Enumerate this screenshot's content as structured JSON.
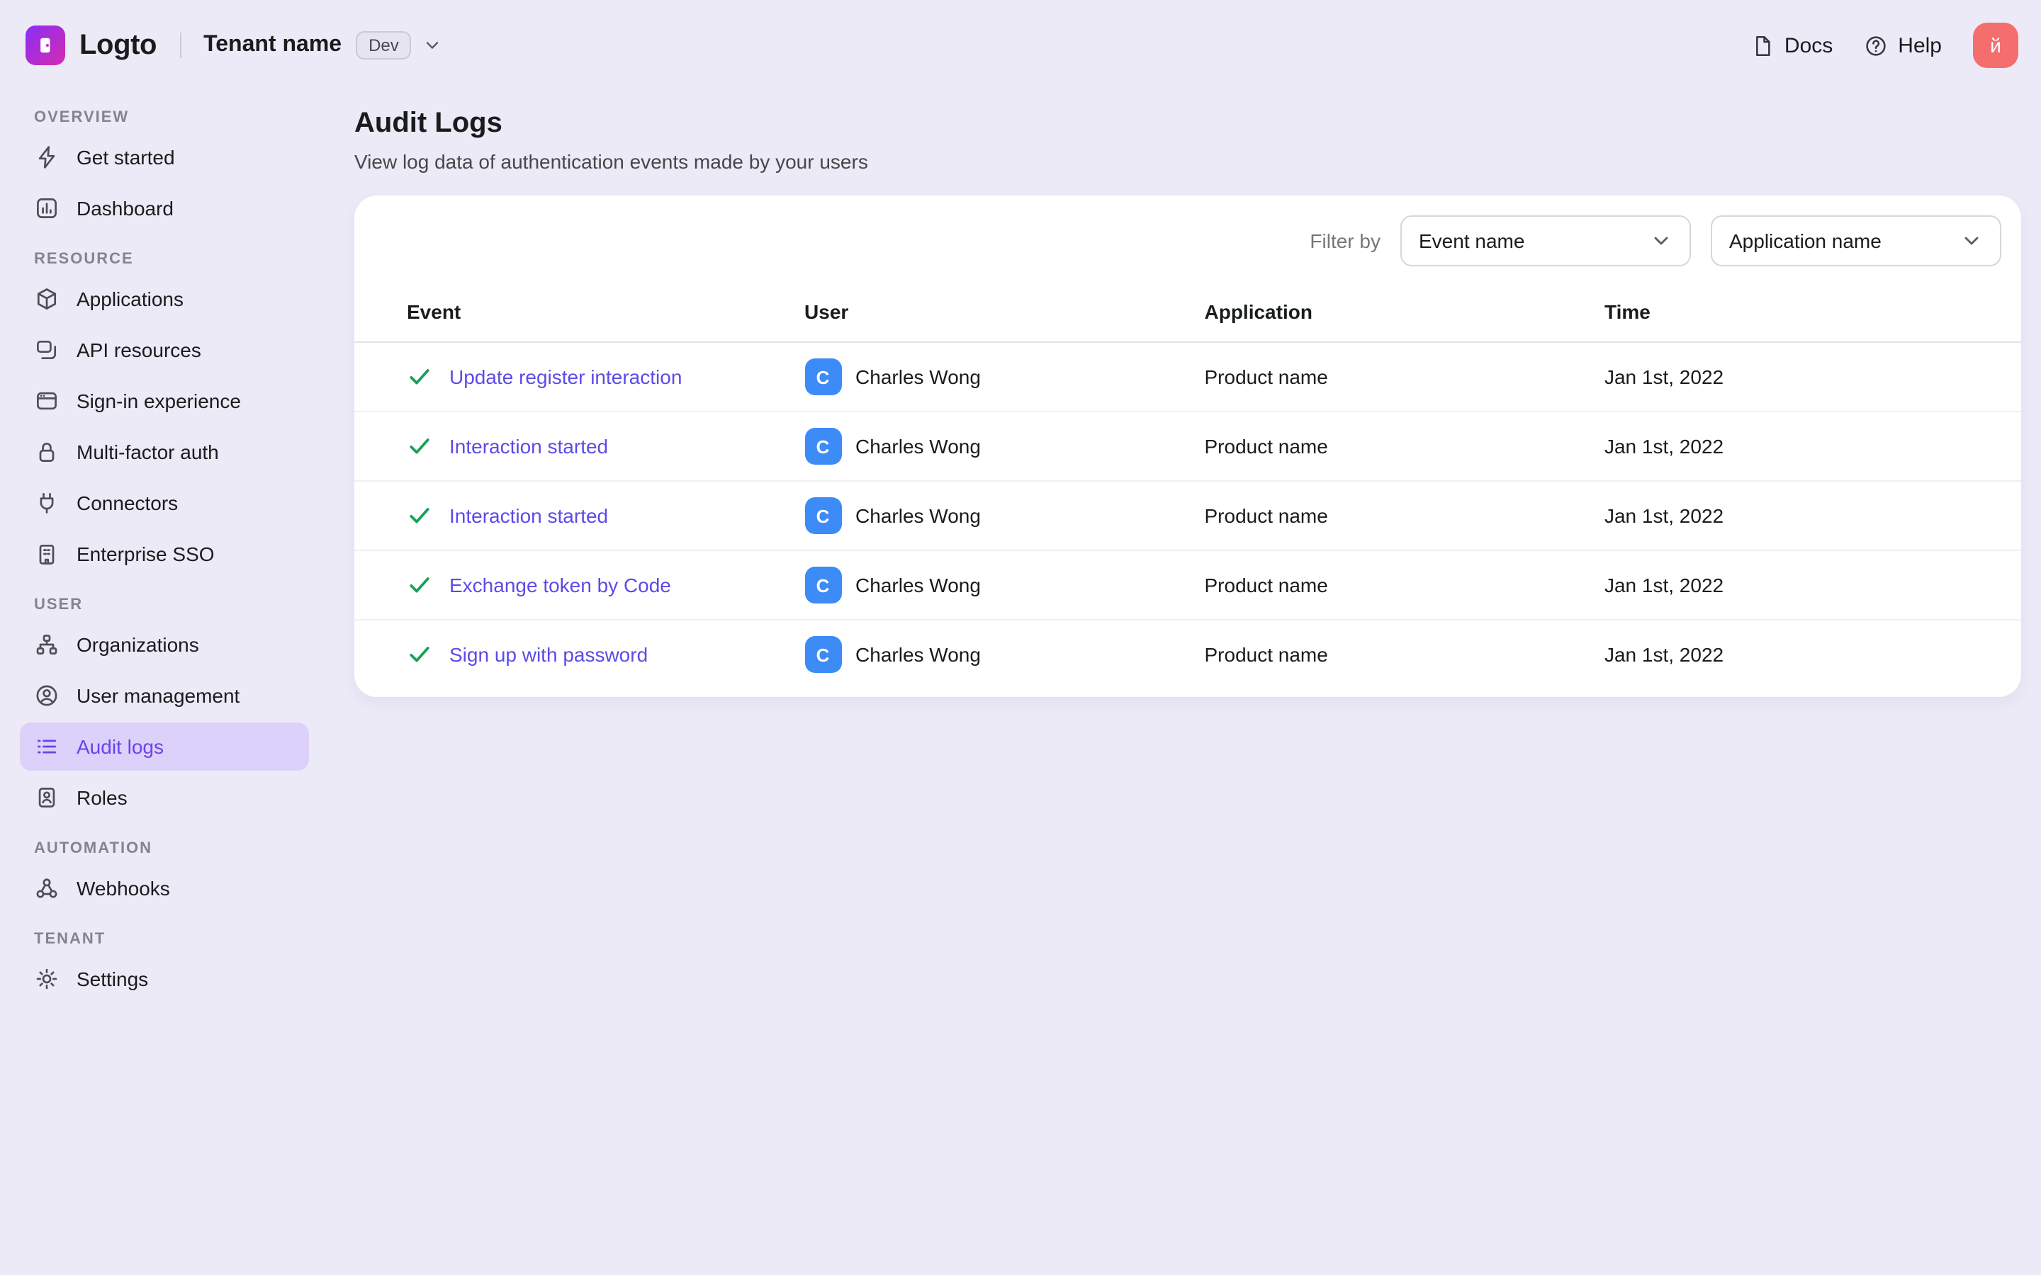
{
  "colors": {
    "accent_purple": "#6C42E8",
    "link_purple": "#5B4BE8",
    "success_green": "#18A05B",
    "user_avatar_blue": "#3D8BF7",
    "profile_avatar_pink": "#F46E6E",
    "page_background": "#ECEAF6",
    "active_nav_background": "#DCD1FA"
  },
  "header": {
    "brand": "Logto",
    "tenant_name": "Tenant name",
    "tenant_env_badge": "Dev",
    "docs_label": "Docs",
    "help_label": "Help",
    "avatar_initial": "й"
  },
  "sidebar": {
    "sections": [
      {
        "label": "OVERVIEW",
        "items": [
          {
            "icon": "bolt-icon",
            "label": "Get started"
          },
          {
            "icon": "dashboard-icon",
            "label": "Dashboard"
          }
        ]
      },
      {
        "label": "RESOURCE",
        "items": [
          {
            "icon": "applications-icon",
            "label": "Applications"
          },
          {
            "icon": "api-resources-icon",
            "label": "API resources"
          },
          {
            "icon": "sign-in-experience-icon",
            "label": "Sign-in experience"
          },
          {
            "icon": "multi-factor-auth-icon",
            "label": "Multi-factor auth"
          },
          {
            "icon": "connectors-icon",
            "label": "Connectors"
          },
          {
            "icon": "enterprise-sso-icon",
            "label": "Enterprise SSO"
          }
        ]
      },
      {
        "label": "USER",
        "items": [
          {
            "icon": "organizations-icon",
            "label": "Organizations"
          },
          {
            "icon": "user-management-icon",
            "label": "User management"
          },
          {
            "icon": "audit-logs-icon",
            "label": "Audit logs",
            "active": true
          },
          {
            "icon": "roles-icon",
            "label": "Roles"
          }
        ]
      },
      {
        "label": "AUTOMATION",
        "items": [
          {
            "icon": "webhooks-icon",
            "label": "Webhooks"
          }
        ]
      },
      {
        "label": "TENANT",
        "items": [
          {
            "icon": "settings-icon",
            "label": "Settings"
          }
        ]
      }
    ]
  },
  "page": {
    "title": "Audit Logs",
    "subtitle": "View log data of authentication events made by your users"
  },
  "filters": {
    "label": "Filter by",
    "event_filter_value": "Event name",
    "application_filter_value": "Application name"
  },
  "table": {
    "columns": [
      "Event",
      "User",
      "Application",
      "Time"
    ],
    "rows": [
      {
        "status": "success",
        "event": "Update register interaction",
        "user_initial": "C",
        "user": "Charles Wong",
        "application": "Product name",
        "time": "Jan 1st, 2022"
      },
      {
        "status": "success",
        "event": "Interaction started",
        "user_initial": "C",
        "user": "Charles Wong",
        "application": "Product name",
        "time": "Jan 1st, 2022"
      },
      {
        "status": "success",
        "event": "Interaction started",
        "user_initial": "C",
        "user": "Charles Wong",
        "application": "Product name",
        "time": "Jan 1st, 2022"
      },
      {
        "status": "success",
        "event": "Exchange token by Code",
        "user_initial": "C",
        "user": "Charles Wong",
        "application": "Product name",
        "time": "Jan 1st, 2022"
      },
      {
        "status": "success",
        "event": "Sign up with password",
        "user_initial": "C",
        "user": "Charles Wong",
        "application": "Product name",
        "time": "Jan 1st, 2022"
      }
    ]
  }
}
